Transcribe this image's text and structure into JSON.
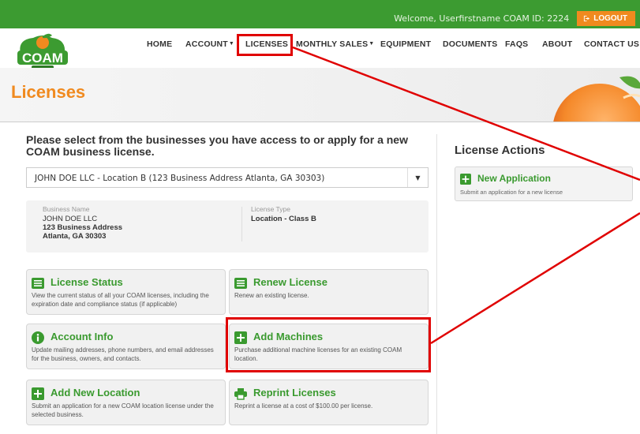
{
  "topbar": {
    "welcome": "Welcome, Userfirstname  COAM ID: 2224",
    "logout_label": "LOGOUT"
  },
  "logo": {
    "text": "COAM",
    "subtext": "DIVISION"
  },
  "nav": {
    "items": [
      {
        "label": "HOME",
        "dropdown": false
      },
      {
        "label": "ACCOUNT",
        "dropdown": true
      },
      {
        "label": "LICENSES",
        "dropdown": false
      },
      {
        "label": "MONTHLY SALES",
        "dropdown": true
      },
      {
        "label": "EQUIPMENT",
        "dropdown": false
      },
      {
        "label": "DOCUMENTS",
        "dropdown": false
      },
      {
        "label": "FAQS",
        "dropdown": false
      },
      {
        "label": "ABOUT",
        "dropdown": false
      },
      {
        "label": "CONTACT US",
        "dropdown": false
      }
    ]
  },
  "hero": {
    "title": "Licenses"
  },
  "main": {
    "intro": "Please select from the businesses you have access to or apply for a new COAM business license.",
    "business_select_value": "JOHN DOE LLC - Location B (123 Business Address Atlanta, GA 30303)",
    "info": {
      "business_name_label": "Business Name",
      "business_name": "JOHN DOE LLC",
      "address_line1": "123 Business Address",
      "address_line2": "Atlanta, GA 30303",
      "license_type_label": "License Type",
      "license_type": "Location - Class B"
    },
    "cards": [
      {
        "title": "License Status",
        "desc": "View the current status of all your COAM licenses, including the expiration date and compliance status (if applicable)",
        "icon": "list-icon"
      },
      {
        "title": "Renew License",
        "desc": "Renew an existing license.",
        "icon": "list-icon"
      },
      {
        "title": "Account Info",
        "desc": "Update mailing addresses, phone numbers, and email addresses for the business, owners, and contacts.",
        "icon": "info-icon"
      },
      {
        "title": "Add Machines",
        "desc": "Purchase additional machine licenses for an existing COAM location.",
        "icon": "plus-square-icon"
      },
      {
        "title": "Add New Location",
        "desc": "Submit an application for a new COAM location license under the selected business.",
        "icon": "plus-square-icon"
      },
      {
        "title": "Reprint Licenses",
        "desc": "Reprint a license at a cost of $100.00 per license.",
        "icon": "printer-icon"
      }
    ]
  },
  "sidebar": {
    "title": "License Actions",
    "new_application_title": "New Application",
    "new_application_desc": "Submit an application for a new license"
  },
  "colors": {
    "brand_green": "#3c9b31",
    "accent_orange": "#f08a1f",
    "annotation_red": "#e00000"
  }
}
